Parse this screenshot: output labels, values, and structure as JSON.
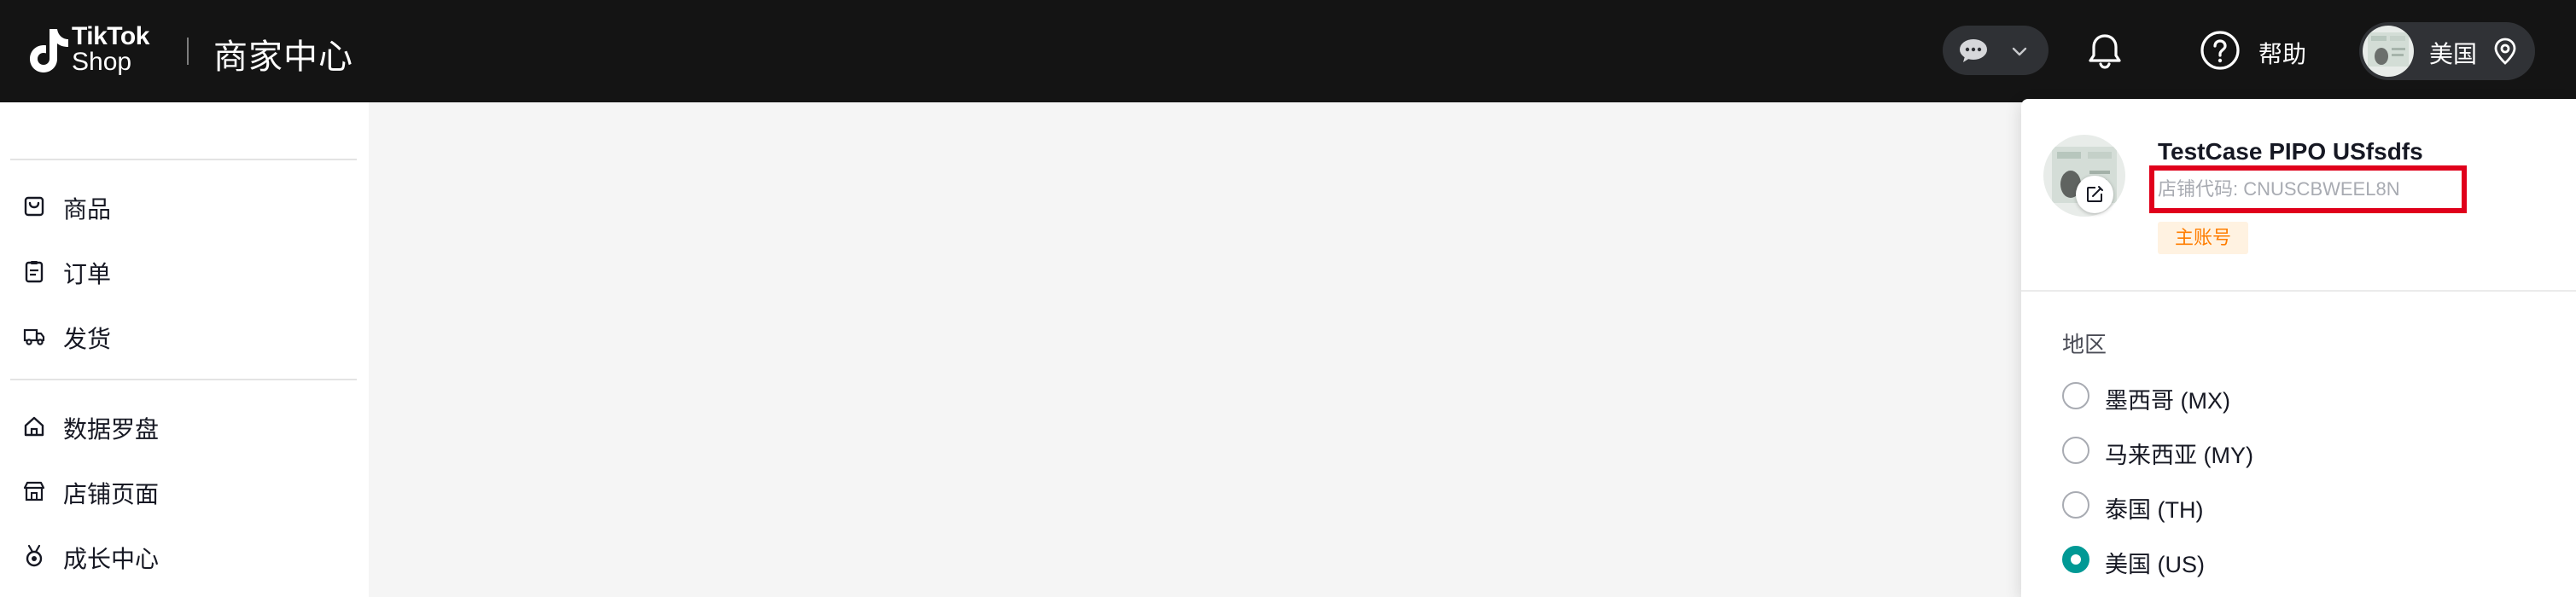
{
  "header": {
    "brand_line1": "TikTok",
    "brand_line2": "Shop",
    "title": "商家中心",
    "help_label": "帮助",
    "account_country": "美国",
    "icons": [
      "tiktok-logo-icon",
      "chat-bubble-icon",
      "chevron-down-icon",
      "bell-icon",
      "help-circle-icon",
      "location-pin-icon"
    ]
  },
  "sidebar": {
    "items": [
      {
        "label": "商品",
        "icon": "bag-icon"
      },
      {
        "label": "订单",
        "icon": "clipboard-icon"
      },
      {
        "label": "发货",
        "icon": "truck-icon"
      },
      {
        "label": "数据罗盘",
        "icon": "home-icon"
      },
      {
        "label": "店铺页面",
        "icon": "store-icon"
      },
      {
        "label": "成长中心",
        "icon": "medal-icon"
      }
    ]
  },
  "account_menu": {
    "store_name": "TestCase PIPO USfsdfs",
    "store_code": "店铺代码: CNUSCBWEEL8N",
    "badge": "主账号",
    "region_title": "地区",
    "regions": [
      {
        "label": "墨西哥 (MX)",
        "selected": false
      },
      {
        "label": "马来西亚 (MY)",
        "selected": false
      },
      {
        "label": "泰国 (TH)",
        "selected": false
      },
      {
        "label": "美国 (US)",
        "selected": true
      }
    ]
  },
  "colors": {
    "header_bg": "#141414",
    "accent_teal": "#009995",
    "highlight_red": "#e0001b",
    "badge_orange": "#ff7d00"
  }
}
